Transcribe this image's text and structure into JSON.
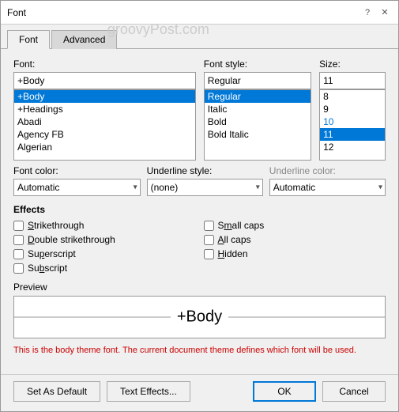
{
  "dialog": {
    "title": "Font",
    "watermark": "groovyPost.com",
    "tabs": [
      {
        "label": "Font",
        "active": true
      },
      {
        "label": "Advanced",
        "active": false
      }
    ]
  },
  "font_section": {
    "font_label": "Font:",
    "font_input_value": "+Body",
    "font_list": [
      {
        "value": "+Body",
        "selected": true
      },
      {
        "value": "+Headings",
        "selected": false
      },
      {
        "value": "Abadi",
        "selected": false
      },
      {
        "value": "Agency FB",
        "selected": false
      },
      {
        "value": "Algerian",
        "selected": false
      }
    ],
    "style_label": "Font style:",
    "style_input_value": "Regular",
    "style_list": [
      {
        "value": "Regular",
        "selected": true
      },
      {
        "value": "Italic",
        "selected": false
      },
      {
        "value": "Bold",
        "selected": false
      },
      {
        "value": "Bold Italic",
        "selected": false
      }
    ],
    "size_label": "Size:",
    "size_input_value": "11",
    "size_list": [
      {
        "value": "8",
        "selected": false
      },
      {
        "value": "9",
        "selected": false
      },
      {
        "value": "10",
        "selected": false
      },
      {
        "value": "11",
        "selected": true
      },
      {
        "value": "12",
        "selected": false
      }
    ]
  },
  "color_section": {
    "font_color_label": "Font color:",
    "font_color_value": "Automatic",
    "underline_style_label": "Underline style:",
    "underline_style_value": "(none)",
    "underline_color_label": "Underline color:",
    "underline_color_value": "Automatic"
  },
  "effects": {
    "title": "Effects",
    "items_left": [
      {
        "label": "Strikethrough",
        "checked": false,
        "underline_char": "S"
      },
      {
        "label": "Double strikethrough",
        "checked": false,
        "underline_char": "D"
      },
      {
        "label": "Superscript",
        "checked": false,
        "underline_char": "p"
      },
      {
        "label": "Subscript",
        "checked": false,
        "underline_char": "b"
      }
    ],
    "items_right": [
      {
        "label": "Small caps",
        "checked": false,
        "underline_char": "m"
      },
      {
        "label": "All caps",
        "checked": false,
        "underline_char": "A"
      },
      {
        "label": "Hidden",
        "checked": false,
        "underline_char": "H"
      }
    ]
  },
  "preview": {
    "title": "Preview",
    "text": "+Body"
  },
  "description": "This is the body theme font. The current document theme defines which font will be used.",
  "footer": {
    "set_default_label": "Set As Default",
    "text_effects_label": "Text Effects...",
    "ok_label": "OK",
    "cancel_label": "Cancel"
  }
}
